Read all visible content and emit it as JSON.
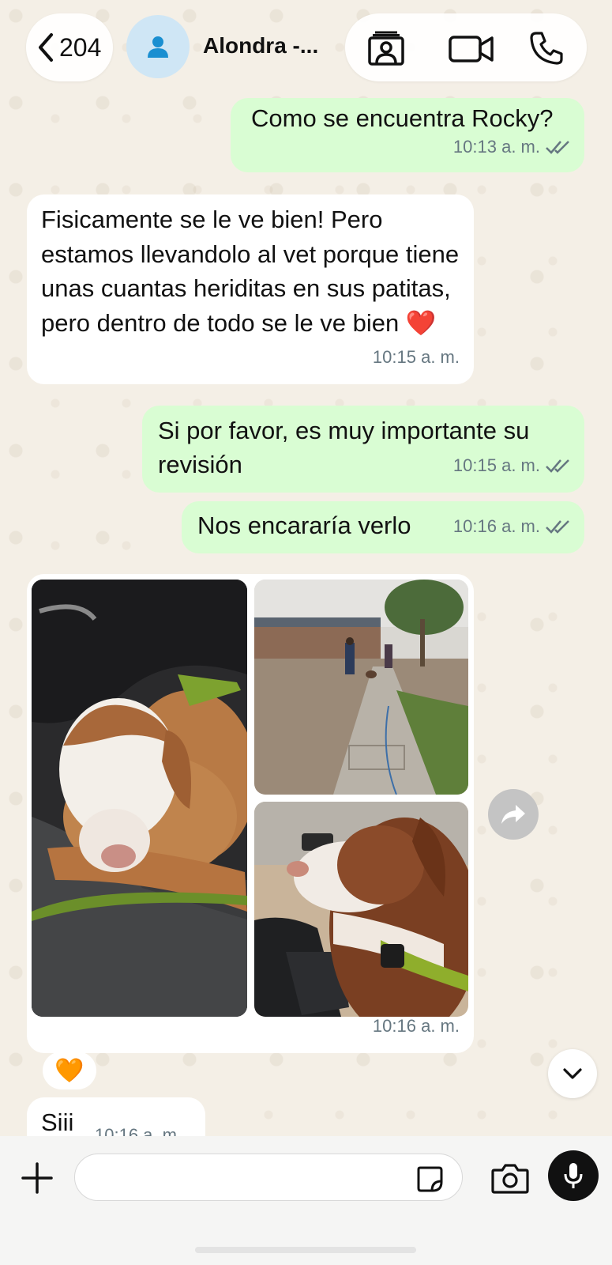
{
  "header": {
    "back_count": "204",
    "contact_name": "Alondra -...",
    "icons": [
      "chevron-left-icon",
      "person-icon",
      "contact-card-icon",
      "video-camera-icon",
      "phone-icon"
    ]
  },
  "messages": [
    {
      "direction": "out",
      "text": "Como se encuentra Rocky?",
      "time": "10:13 a. m.",
      "status": "read"
    },
    {
      "direction": "in",
      "text": "Fisicamente se le ve bien! Pero estamos llevandolo al vet porque tiene unas cuantas heriditas en sus patitas, pero dentro de todo se le ve bien ❤️",
      "time": "10:15 a. m."
    },
    {
      "direction": "out",
      "text": "Si por favor, es muy importante su revisión",
      "time": "10:15 a. m.",
      "status": "read"
    },
    {
      "direction": "out",
      "text": "Nos encararía verlo",
      "time": "10:16 a. m.",
      "status": "read"
    },
    {
      "direction": "in",
      "type": "photo-album",
      "photo_count": 3,
      "time": "10:16 a. m.",
      "reaction": "🧡"
    },
    {
      "direction": "in",
      "text": "Siii",
      "time": "10:16 a. m."
    }
  ],
  "composer": {
    "placeholder": "",
    "icons": [
      "plus-icon",
      "sticker-icon",
      "camera-icon",
      "microphone-icon"
    ]
  },
  "colors": {
    "outgoing_bubble": "#d9fdd3",
    "incoming_bubble": "#ffffff",
    "wallpaper": "#f4efe6",
    "read_tick": "#667781"
  }
}
